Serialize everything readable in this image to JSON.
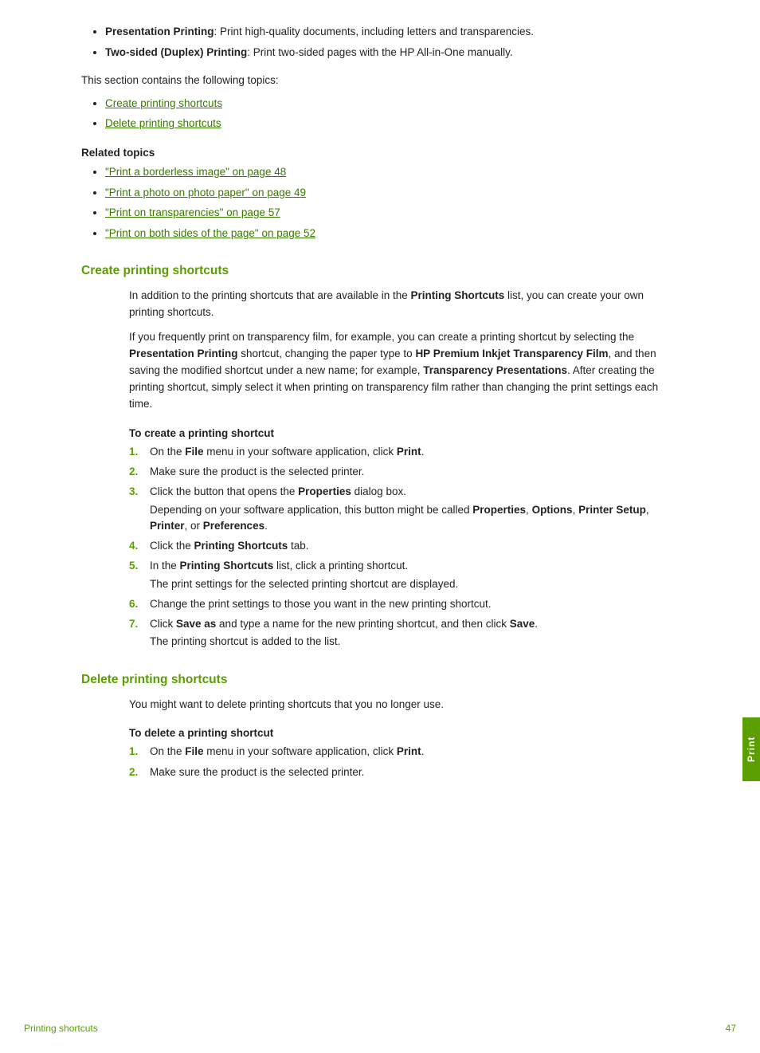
{
  "page": {
    "top_bullets": [
      {
        "label": "Presentation Printing",
        "label_bold": true,
        "text": ": Print high-quality documents, including letters and transparencies."
      },
      {
        "label": "Two-sided (Duplex) Printing",
        "label_bold": true,
        "text": ": Print two-sided pages with the HP All-in-One manually."
      }
    ],
    "intro_text": "This section contains the following topics:",
    "topic_links": [
      {
        "text": "Create printing shortcuts"
      },
      {
        "text": "Delete printing shortcuts"
      }
    ],
    "related_topics": {
      "label": "Related topics",
      "links": [
        {
          "text": "“Print a borderless image” on page 48"
        },
        {
          "text": "“Print a photo on photo paper” on page 49"
        },
        {
          "text": "“Print on transparencies” on page 57"
        },
        {
          "text": "“Print on both sides of the page” on page 52"
        }
      ]
    },
    "section1": {
      "heading": "Create printing shortcuts",
      "para1": "In addition to the printing shortcuts that are available in the <b>Printing Shortcuts</b> list, you can create your own printing shortcuts.",
      "para2": "If you frequently print on transparency film, for example, you can create a printing shortcut by selecting the <b>Presentation Printing</b> shortcut, changing the paper type to <b>HP Premium Inkjet Transparency Film</b>, and then saving the modified shortcut under a new name; for example, <b>Transparency Presentations</b>. After creating the printing shortcut, simply select it when printing on transparency film rather than changing the print settings each time.",
      "sub_heading": "To create a printing shortcut",
      "steps": [
        {
          "num": "1.",
          "text": "On the <b>File</b> menu in your software application, click <b>Print</b>.",
          "sub": ""
        },
        {
          "num": "2.",
          "text": "Make sure the product is the selected printer.",
          "sub": ""
        },
        {
          "num": "3.",
          "text": "Click the button that opens the <b>Properties</b> dialog box.",
          "sub": "Depending on your software application, this button might be called <b>Properties</b>, <b>Options</b>, <b>Printer Setup</b>, <b>Printer</b>, or <b>Preferences</b>."
        },
        {
          "num": "4.",
          "text": "Click the <b>Printing Shortcuts</b> tab.",
          "sub": ""
        },
        {
          "num": "5.",
          "text": "In the <b>Printing Shortcuts</b> list, click a printing shortcut.",
          "sub": "The print settings for the selected printing shortcut are displayed."
        },
        {
          "num": "6.",
          "text": "Change the print settings to those you want in the new printing shortcut.",
          "sub": ""
        },
        {
          "num": "7.",
          "text": "Click <b>Save as</b> and type a name for the new printing shortcut, and then click <b>Save</b>.",
          "sub": "The printing shortcut is added to the list."
        }
      ]
    },
    "section2": {
      "heading": "Delete printing shortcuts",
      "para1": "You might want to delete printing shortcuts that you no longer use.",
      "sub_heading": "To delete a printing shortcut",
      "steps": [
        {
          "num": "1.",
          "text": "On the <b>File</b> menu in your software application, click <b>Print</b>.",
          "sub": ""
        },
        {
          "num": "2.",
          "text": "Make sure the product is the selected printer.",
          "sub": ""
        }
      ]
    },
    "sidebar_tab": "Print",
    "footer": {
      "left": "Printing shortcuts",
      "right": "47"
    }
  }
}
